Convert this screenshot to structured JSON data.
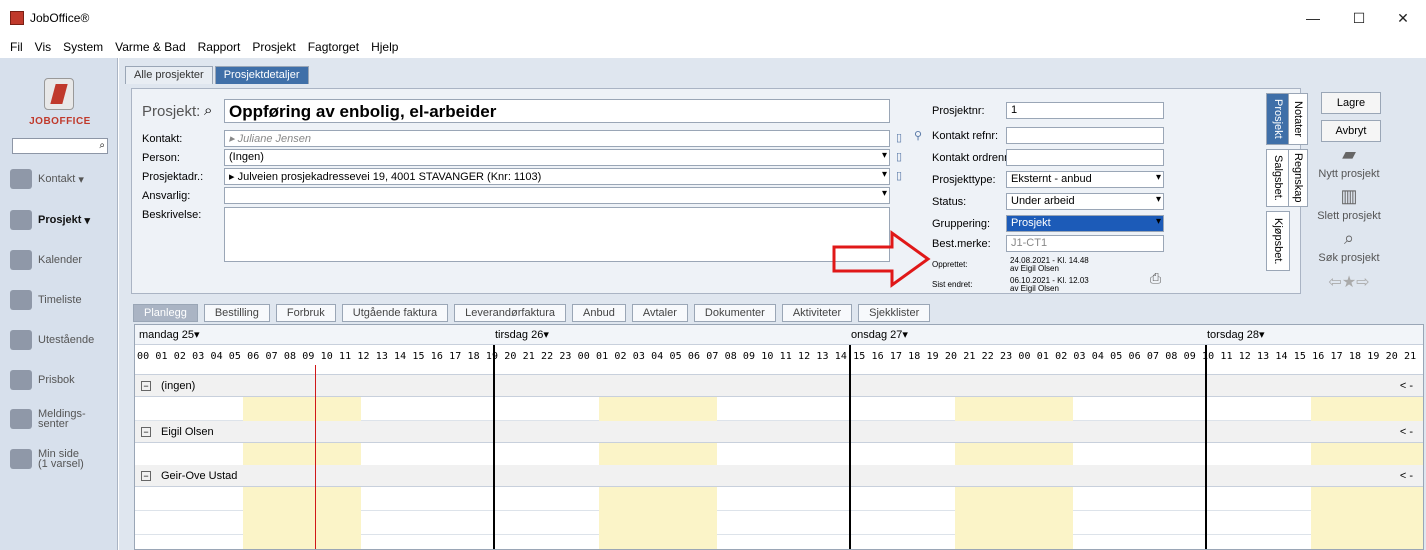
{
  "window": {
    "title": "JobOffice®"
  },
  "menu": [
    "Fil",
    "Vis",
    "System",
    "Varme & Bad",
    "Rapport",
    "Prosjekt",
    "Fagtorget",
    "Hjelp"
  ],
  "sidebar": {
    "logo_text": "JOBOFFICE",
    "items": [
      {
        "label": "Kontakt",
        "chevron": "▾"
      },
      {
        "label": "Prosjekt",
        "chevron": "▾"
      },
      {
        "label": "Kalender"
      },
      {
        "label": "Timeliste"
      },
      {
        "label": "Utestående"
      },
      {
        "label": "Prisbok"
      },
      {
        "label": "Meldings-\nsenter"
      },
      {
        "label": "Min side\n(1 varsel)"
      }
    ]
  },
  "top_tabs": [
    "Alle prosjekter",
    "Prosjektdetaljer"
  ],
  "project": {
    "title_label": "Prosjekt:",
    "name": "Oppføring av enbolig, el-arbeider",
    "contact_label": "Kontakt:",
    "contact": "Juliane Jensen",
    "person_label": "Person:",
    "person": "(Ingen)",
    "address_label": "Prosjektadr.:",
    "address": "Julveien prosjekadressevei 19, 4001 STAVANGER (Knr: 1103)",
    "responsible_label": "Ansvarlig:",
    "description_label": "Beskrivelse:",
    "nr_label": "Prosjektnr:",
    "nr": "1",
    "contact_ref_label": "Kontakt refnr:",
    "contact_order_label": "Kontakt ordrenr:",
    "type_label": "Prosjekttype:",
    "type": "Eksternt - anbud",
    "status_label": "Status:",
    "status": "Under arbeid",
    "grouping_label": "Gruppering:",
    "grouping": "Prosjekt",
    "mark_label": "Best.merke:",
    "mark": "J1-CT1",
    "created_label": "Opprettet:",
    "created": "24.08.2021 - Kl. 14.48",
    "created_by": "av Eigil Olsen",
    "changed_label": "Sist endret:",
    "changed": "06.10.2021 - Kl. 12.03",
    "changed_by": "av Eigil Olsen"
  },
  "side_tabs": [
    "Prosjekt",
    "Notater",
    "Salgsbet.",
    "Regnskap",
    "Kjøpsbet."
  ],
  "actions": {
    "save": "Lagre",
    "cancel": "Avbryt",
    "new_project": "Nytt prosjekt",
    "delete_project": "Slett prosjekt",
    "search_project": "Søk prosjekt"
  },
  "lower_tabs": [
    "Planlegg",
    "Bestilling",
    "Forbruk",
    "Utgående faktura",
    "Leverandørfaktura",
    "Anbud",
    "Avtaler",
    "Dokumenter",
    "Aktiviteter",
    "Sjekklister"
  ],
  "calendar": {
    "days": [
      "mandag 25",
      "tirsdag 26",
      "onsdag 27",
      "torsdag 28"
    ],
    "hours": "00 01 02 03 04 05 06 07 08 09 10 11 12 13 14 15 16 17 18 19 20 21 22 23 00 01 02 03 04 05 06 07 08 09 10 11 12 13 14 15 16 17 18 19 20 21 22 23 00 01 02 03 04 05 06 07 08 09 10 11 12 13 14 15 16 17 18 19 20 21 22 23 00 01 02 03 04 05 06 07 08 09 10 11 12 13",
    "groups": [
      "(ingen)",
      "Eigil Olsen",
      "Geir-Ove Ustad"
    ],
    "nav": "< -"
  }
}
